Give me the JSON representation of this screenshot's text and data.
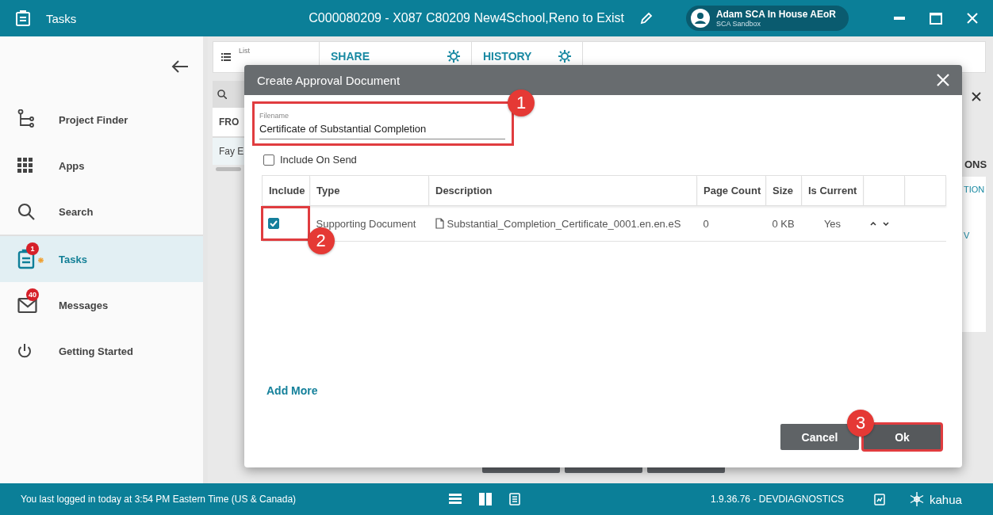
{
  "window": {
    "title": "Tasks",
    "project": "C000080209 - X087 C80209 New4School,Reno to Exist"
  },
  "user": {
    "name": "Adam SCA In House AEoR",
    "environment": "SCA Sandbox"
  },
  "sidebar": {
    "items": [
      {
        "label": "Project Finder",
        "kind": "tree",
        "selected": false,
        "starred": false
      },
      {
        "label": "Apps",
        "kind": "grid",
        "selected": false,
        "starred": false
      },
      {
        "label": "Search",
        "kind": "search",
        "selected": false,
        "starred": false
      },
      {
        "label": "Tasks",
        "kind": "clipboard",
        "selected": true,
        "starred": true,
        "badge": "1"
      },
      {
        "label": "Messages",
        "kind": "mail",
        "selected": false,
        "starred": false,
        "badge": "40"
      },
      {
        "label": "Getting Started",
        "kind": "power",
        "selected": false,
        "starred": false
      }
    ]
  },
  "background": {
    "toolbar": {
      "list_label": "List",
      "tabs": [
        "SHARE",
        "HISTORY"
      ]
    },
    "list": {
      "column": "FRO",
      "row": "Fay E"
    },
    "side": {
      "heading": "ONS",
      "links": [
        "TION",
        "V"
      ]
    }
  },
  "dialog": {
    "title": "Create Approval Document",
    "filename": {
      "label": "Filename",
      "value": "Certificate of Substantial Completion",
      "callout": "1"
    },
    "include_on_send": {
      "label": "Include On Send",
      "checked": false
    },
    "table": {
      "columns": [
        "Include",
        "Type",
        "Description",
        "Page Count",
        "Size",
        "Is Current"
      ],
      "rows": [
        {
          "include": true,
          "type": "Supporting Document",
          "description": "Substantial_Completion_Certificate_0001.en.en.eS",
          "page_count": "0",
          "size": "0 KB",
          "is_current": "Yes",
          "callout": "2"
        }
      ]
    },
    "add_more": "Add More",
    "buttons": [
      {
        "label": "Cancel",
        "highlighted": false
      },
      {
        "label": "Ok",
        "highlighted": true,
        "callout": "3"
      }
    ]
  },
  "status_bar": {
    "message": "You last logged in today at 3:54 PM Eastern Time (US & Canada)",
    "version": "1.9.36.76 - DEVDIAGNOSTICS",
    "brand": "kahua"
  }
}
